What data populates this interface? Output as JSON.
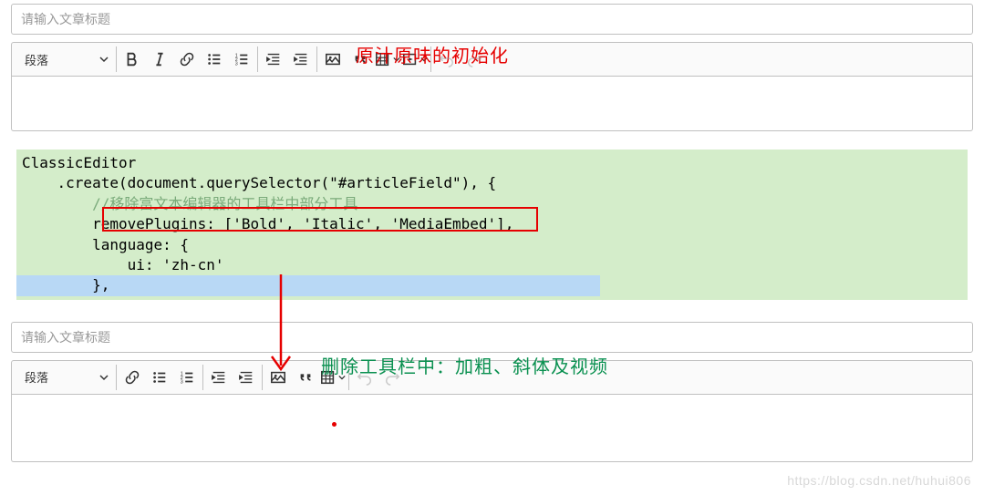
{
  "titleInput": {
    "placeholder": "请输入文章标题"
  },
  "toolbar1": {
    "heading": "段落",
    "icons": [
      "bold",
      "italic",
      "link",
      "bulleted-list",
      "numbered-list",
      "outdent",
      "indent",
      "image",
      "quote",
      "table",
      "media",
      "undo",
      "redo"
    ]
  },
  "toolbar2": {
    "heading": "段落",
    "icons": [
      "link",
      "bulleted-list",
      "numbered-list",
      "outdent",
      "indent",
      "image",
      "quote",
      "table",
      "undo",
      "redo"
    ]
  },
  "annotations": {
    "top": "原汁原味的初始化",
    "mid": "删除工具栏中：加粗、斜体及视频"
  },
  "code": {
    "l1": "ClassicEditor",
    "l2": "    .create(document.querySelector(\"#articleField\"), {",
    "l3": "        //移除富文本编辑器的工具栏中部分工具",
    "l4": "        removePlugins: ['Bold', 'Italic', 'MediaEmbed'],",
    "l5": "        language: {",
    "l6": "            ui: 'zh-cn'",
    "l7": "        },"
  },
  "watermark": "https://blog.csdn.net/huhui806"
}
